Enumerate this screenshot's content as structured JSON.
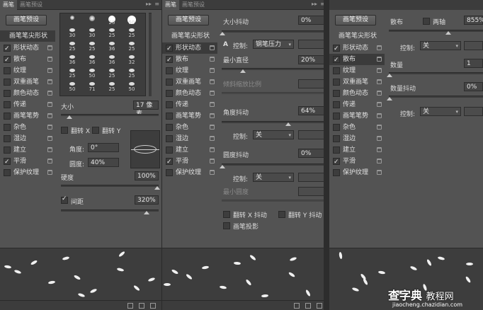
{
  "panel1": {
    "tabs": [
      "画笔",
      "画笔预设"
    ],
    "preset_button": "画笔预设",
    "list_header": "画笔笔尖形状",
    "items": [
      {
        "label": "形状动态",
        "checked": true
      },
      {
        "label": "散布",
        "checked": true
      },
      {
        "label": "纹理",
        "checked": false
      },
      {
        "label": "双重画笔",
        "checked": false
      },
      {
        "label": "颜色动态",
        "checked": false
      },
      {
        "label": "传递",
        "checked": false
      },
      {
        "label": "画笔笔势",
        "checked": false
      },
      {
        "label": "杂色",
        "checked": false
      },
      {
        "label": "湿边",
        "checked": false
      },
      {
        "label": "建立",
        "checked": false
      },
      {
        "label": "平滑",
        "checked": true
      },
      {
        "label": "保护纹理",
        "checked": false
      }
    ],
    "brush_sizes": [
      "30",
      "30",
      "25",
      "25",
      "25",
      "25",
      "36",
      "25",
      "36",
      "36",
      "36",
      "32",
      "25",
      "50",
      "25",
      "25",
      "50",
      "71",
      "25",
      "50"
    ],
    "brush_sizes_top": [
      "25",
      "50"
    ],
    "size_label": "大小",
    "size_value": "17 像素",
    "flip_x": "翻转 X",
    "flip_y": "翻转 Y",
    "angle_label": "角度:",
    "angle_value": "0°",
    "roundness_label": "圆度:",
    "roundness_value": "40%",
    "hardness_label": "硬度",
    "hardness_value": "100%",
    "spacing_label": "间距",
    "spacing_value": "320%"
  },
  "panel2": {
    "tabs": [
      "画笔",
      "画笔预设"
    ],
    "preset_button": "画笔预设",
    "list_header": "画笔笔尖形状",
    "items": [
      {
        "label": "形状动态",
        "checked": true
      },
      {
        "label": "散布",
        "checked": true
      },
      {
        "label": "纹理",
        "checked": false
      },
      {
        "label": "双重画笔",
        "checked": false
      },
      {
        "label": "颜色动态",
        "checked": false
      },
      {
        "label": "传递",
        "checked": false
      },
      {
        "label": "画笔笔势",
        "checked": false
      },
      {
        "label": "杂色",
        "checked": false
      },
      {
        "label": "湿边",
        "checked": false
      },
      {
        "label": "建立",
        "checked": false
      },
      {
        "label": "平滑",
        "checked": true
      },
      {
        "label": "保护纹理",
        "checked": false
      }
    ],
    "size_jitter_label": "大小抖动",
    "size_jitter_value": "0%",
    "control_label": "控制:",
    "control1_value": "钢笔压力",
    "min_diameter_label": "最小直径",
    "min_diameter_value": "20%",
    "tilt_scale_label": "倾斜缩放比例",
    "angle_jitter_label": "角度抖动",
    "angle_jitter_value": "64%",
    "control2_value": "关",
    "roundness_jitter_label": "圆度抖动",
    "roundness_jitter_value": "0%",
    "control3_value": "关",
    "min_roundness_label": "最小圆度",
    "flip_x_jitter": "翻转 X 抖动",
    "flip_y_jitter": "翻转 Y 抖动",
    "brush_projection": "画笔投影"
  },
  "panel3": {
    "preset_button": "画笔预设",
    "list_header": "画笔笔尖形状",
    "items": [
      {
        "label": "形状动态",
        "checked": true
      },
      {
        "label": "散布",
        "checked": true
      },
      {
        "label": "纹理",
        "checked": false
      },
      {
        "label": "双重画笔",
        "checked": false
      },
      {
        "label": "颜色动态",
        "checked": false
      },
      {
        "label": "传递",
        "checked": false
      },
      {
        "label": "画笔笔势",
        "checked": false
      },
      {
        "label": "杂色",
        "checked": false
      },
      {
        "label": "湿边",
        "checked": false
      },
      {
        "label": "建立",
        "checked": false
      },
      {
        "label": "平滑",
        "checked": true
      },
      {
        "label": "保护纹理",
        "checked": false
      }
    ],
    "scatter_label": "散布",
    "both_axes_label": "两轴",
    "scatter_value": "855%",
    "control_label": "控制:",
    "control1_value": "关",
    "count_label": "数量",
    "count_value": "1",
    "count_jitter_label": "数量抖动",
    "count_jitter_value": "0%",
    "control2_value": "关"
  },
  "watermark": {
    "main": "查字典",
    "sub": "教程网",
    "url": "jiaocheng.chazidian.com"
  }
}
